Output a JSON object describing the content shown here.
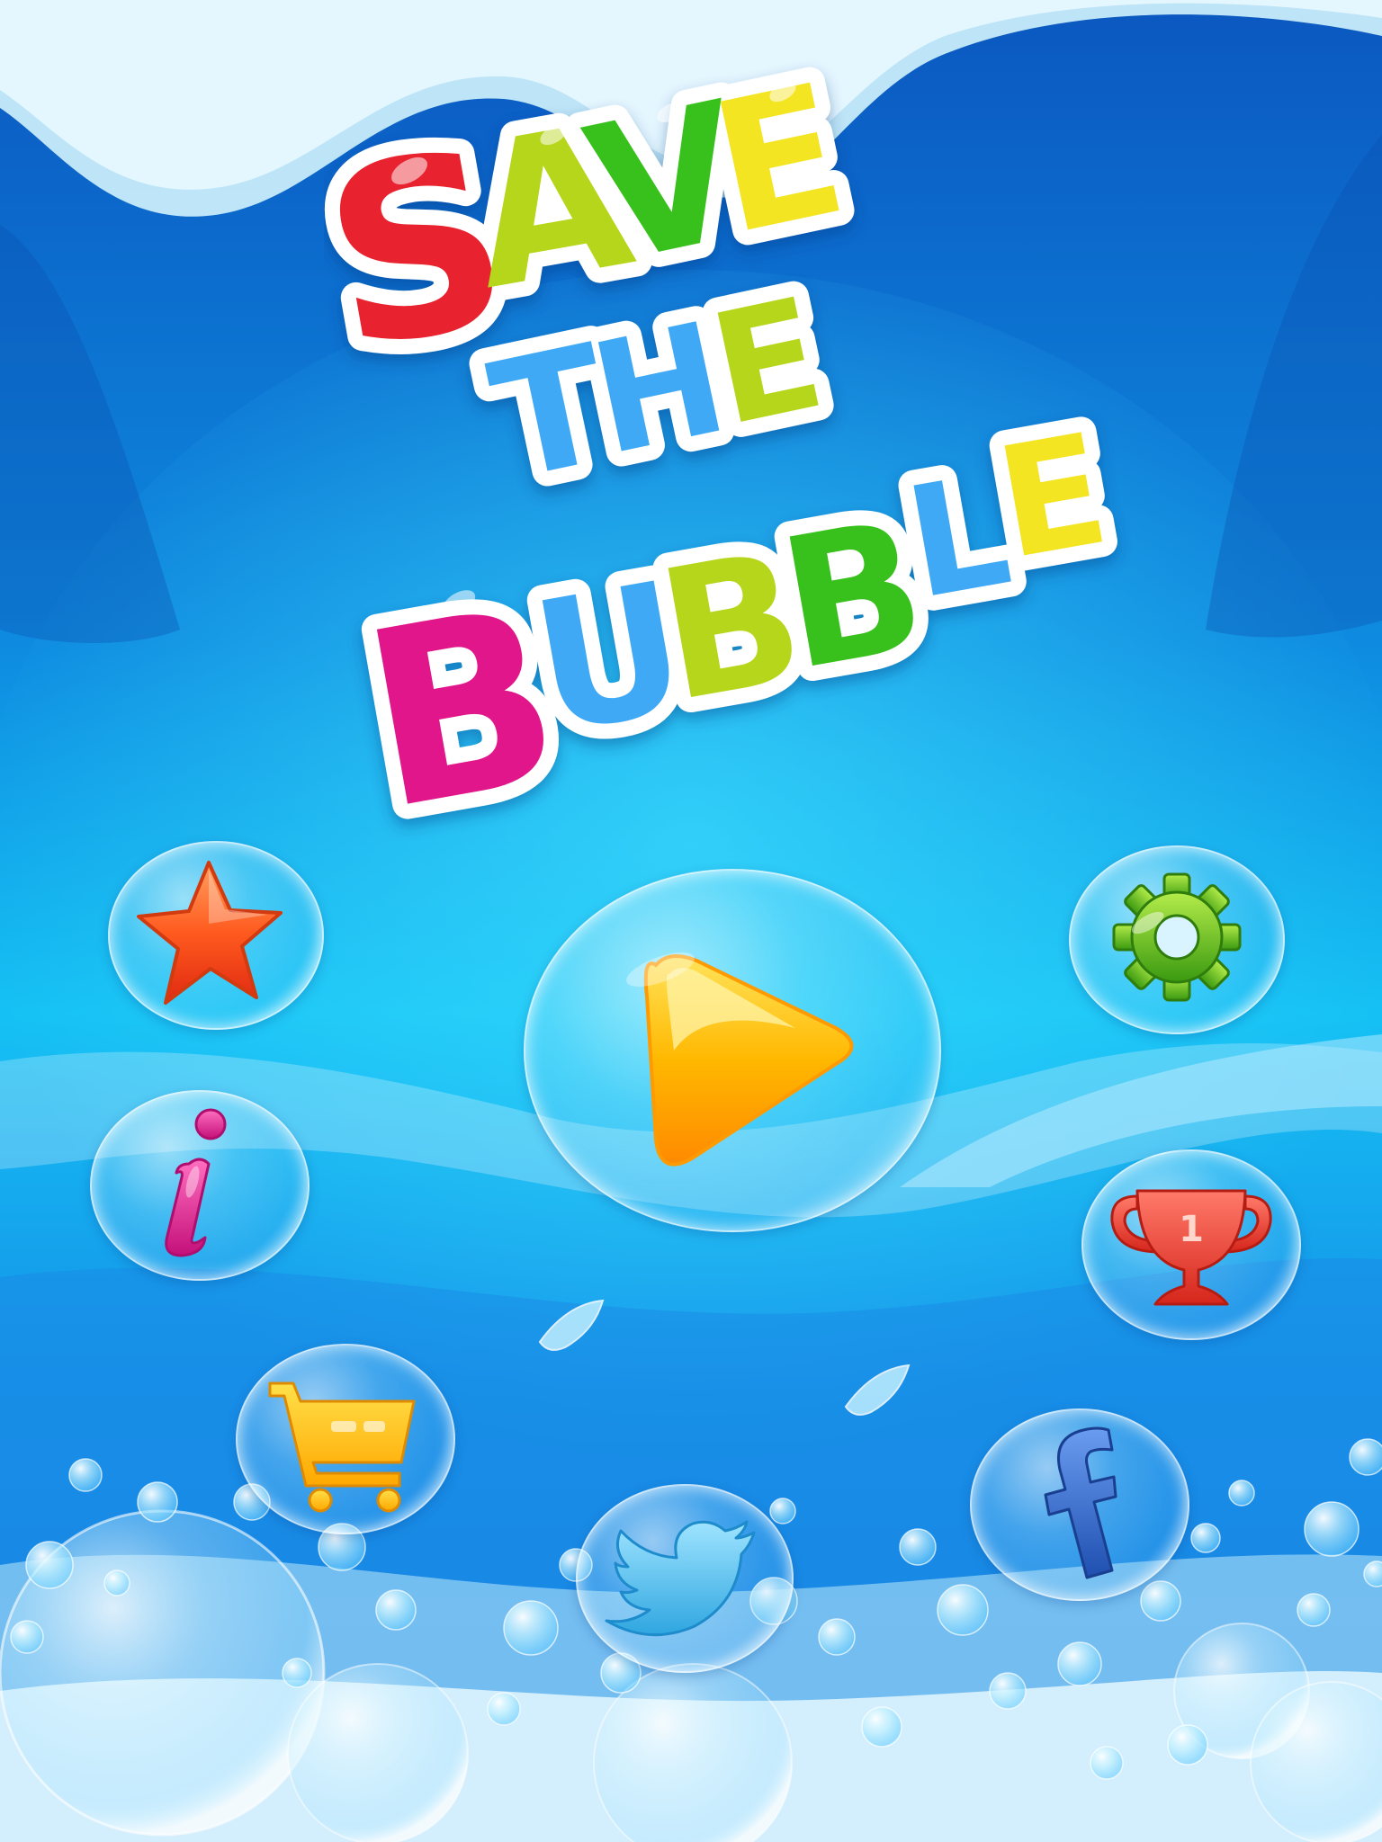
{
  "title": {
    "line1": [
      "S",
      "A",
      "V",
      "E"
    ],
    "line2": [
      "T",
      "H",
      "E"
    ],
    "line3": [
      "B",
      "U",
      "B",
      "B",
      "L",
      "E"
    ]
  },
  "colors": {
    "sky_top": "#0a5fc4",
    "sky_mid": "#12b6f0",
    "sky_bottom": "#1a7ee0",
    "red": "#e8242e",
    "green": "#39c11c",
    "yellow": "#f4e523",
    "lime": "#b6d61c",
    "blue": "#3fa9f5",
    "pink": "#e0188a",
    "play_orange": "#ffb400"
  },
  "buttons": {
    "play": "play-icon",
    "favorites": "star-icon",
    "settings": "gear-icon",
    "info": "info-icon",
    "leaderboard": "trophy-icon",
    "shop": "cart-icon",
    "twitter": "twitter-icon",
    "facebook": "facebook-icon"
  }
}
